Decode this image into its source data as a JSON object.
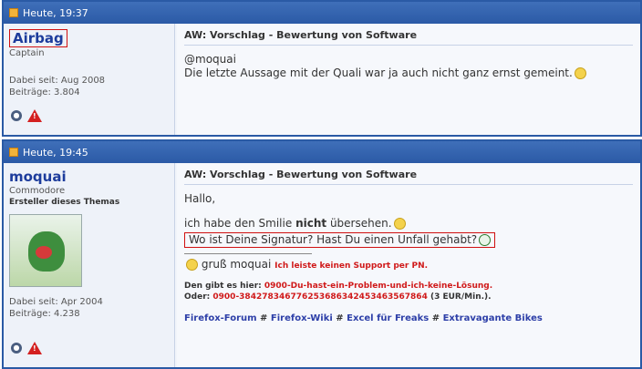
{
  "post1": {
    "timestamp": "Heute, 19:37",
    "username": "Airbag",
    "rank": "Captain",
    "joined": "Dabei seit: Aug 2008",
    "posts": "Beiträge: 3.804",
    "subject": "AW: Vorschlag - Bewertung von Software",
    "line1": "@moquai",
    "line2": "Die letzte Aussage mit der Quali war ja auch nicht ganz ernst gemeint."
  },
  "post2": {
    "timestamp": "Heute, 19:45",
    "username": "moquai",
    "rank": "Commodore",
    "rank_extra": "Ersteller dieses Themas",
    "joined": "Dabei seit: Apr 2004",
    "posts": "Beiträge: 4.238",
    "subject": "AW: Vorschlag - Bewertung von Software",
    "greeting": "Hallo,",
    "line_pre": "ich habe den Smilie ",
    "line_bold": "nicht",
    "line_post": " übersehen.",
    "highlight": "Wo ist Deine Signatur? Hast Du einen Unfall gehabt?",
    "sig_greeting": "gruß moquai",
    "sig_support": "Ich leiste keinen Support per PN.",
    "sig_line1_label": "Den gibt es hier:",
    "sig_line1_value": "0900-Du-hast-ein-Problem-und-ich-keine-Lösung.",
    "sig_line2_label": "Oder:",
    "sig_line2_value": "0900-384278346776253686342453463567864",
    "sig_line2_cost": "(3 EUR/Min.).",
    "links": [
      "Firefox-Forum",
      "Firefox-Wiki",
      "Excel für Freaks",
      "Extravagante Bikes"
    ],
    "link_sep": "#"
  },
  "icons": {
    "profile": "profile-circle-icon",
    "report": "warning-triangle-icon",
    "post": "document-icon"
  },
  "colors": {
    "header": "#2b5aa6",
    "username": "#1d3c9c",
    "highlight_border": "#d01010"
  }
}
